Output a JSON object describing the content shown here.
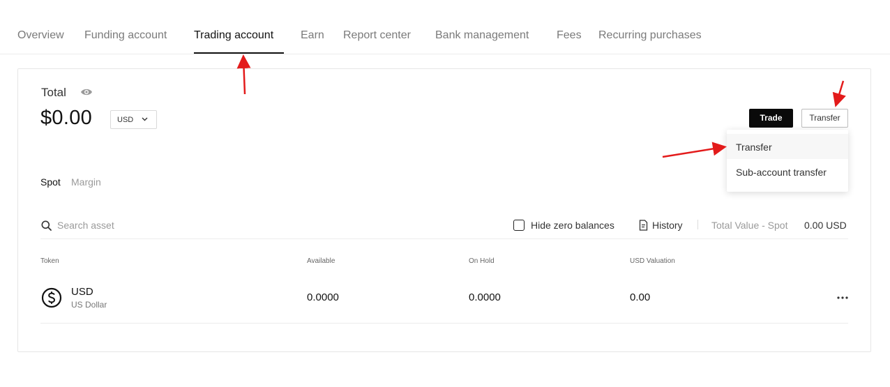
{
  "nav": {
    "tabs": [
      {
        "label": "Overview"
      },
      {
        "label": "Funding account"
      },
      {
        "label": "Trading account"
      },
      {
        "label": "Earn"
      },
      {
        "label": "Report center"
      },
      {
        "label": "Bank management"
      },
      {
        "label": "Fees"
      },
      {
        "label": "Recurring purchases"
      }
    ],
    "active": "Trading account"
  },
  "summary": {
    "total_label": "Total",
    "amount": "$0.00",
    "currency": "USD"
  },
  "actions": {
    "trade_label": "Trade",
    "transfer_label": "Transfer"
  },
  "transfer_menu": {
    "items": [
      {
        "label": "Transfer"
      },
      {
        "label": "Sub-account transfer"
      }
    ]
  },
  "subtabs": [
    {
      "label": "Spot"
    },
    {
      "label": "Margin"
    }
  ],
  "toolbar": {
    "search_placeholder": "Search asset",
    "hide_zero_label": "Hide zero balances",
    "history_label": "History",
    "total_value_label": "Total Value - Spot",
    "total_value": "0.00 USD"
  },
  "table": {
    "columns": [
      "Token",
      "Available",
      "On Hold",
      "USD Valuation"
    ],
    "rows": [
      {
        "symbol": "USD",
        "name": "US Dollar",
        "available": "0.0000",
        "on_hold": "0.0000",
        "usd_valuation": "0.00"
      }
    ]
  },
  "colors": {
    "accent_dark": "#0a0a0a",
    "annotation_red": "#e31b1b",
    "muted_text": "#7a7a7a"
  }
}
